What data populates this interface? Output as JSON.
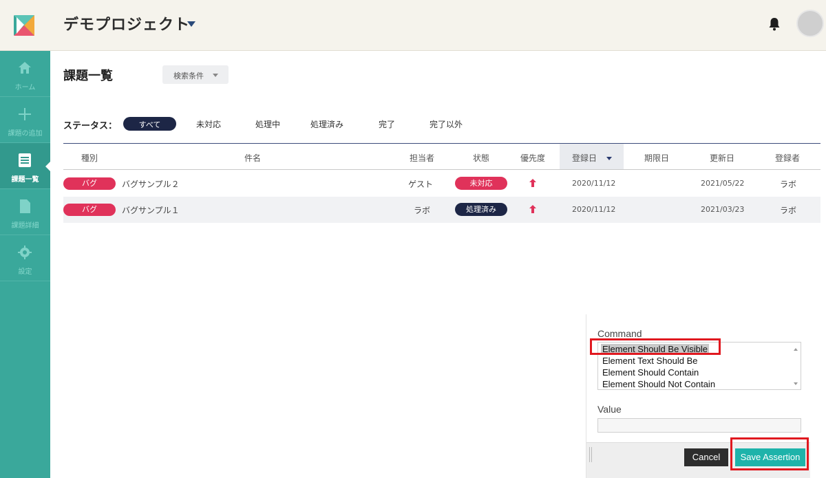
{
  "header": {
    "project_title": "デモプロジェクト"
  },
  "sidebar": {
    "items": [
      {
        "label": "ホーム",
        "icon": "home-icon"
      },
      {
        "label": "課題の追加",
        "icon": "plus-icon"
      },
      {
        "label": "課題一覧",
        "icon": "list-icon",
        "active": true
      },
      {
        "label": "課題詳細",
        "icon": "document-icon"
      },
      {
        "label": "設定",
        "icon": "gear-icon"
      }
    ]
  },
  "page": {
    "title": "課題一覧",
    "filter_label": "検索条件"
  },
  "status_filter": {
    "label": "ステータス：",
    "options": [
      "すべて",
      "未対応",
      "処理中",
      "処理済み",
      "完了",
      "完了以外"
    ],
    "selected": "すべて"
  },
  "table": {
    "columns": [
      "種別",
      "件名",
      "担当者",
      "状態",
      "優先度",
      "登録日",
      "期限日",
      "更新日",
      "登録者"
    ],
    "sorted_column": "登録日",
    "rows": [
      {
        "type": "バグ",
        "subject": "バグサンプル２",
        "assignee": "ゲスト",
        "status": "未対応",
        "priority": "high",
        "registered": "2020/11/12",
        "due": "",
        "updated": "2021/05/22",
        "registrant": "ラボ"
      },
      {
        "type": "バグ",
        "subject": "バグサンプル１",
        "assignee": "ラボ",
        "status": "処理済み",
        "priority": "high",
        "registered": "2020/11/12",
        "due": "",
        "updated": "2021/03/23",
        "registrant": "ラボ"
      }
    ]
  },
  "assertion_panel": {
    "command_label": "Command",
    "commands": [
      "Element Should Be Visible",
      "Element Text Should Be",
      "Element Should Contain",
      "Element Should Not Contain"
    ],
    "selected_command": "Element Should Be Visible",
    "value_label": "Value",
    "value": "",
    "cancel_label": "Cancel",
    "save_label": "Save Assertion"
  },
  "colors": {
    "accent": "#3aa89b",
    "navy": "#1d2646",
    "bug_red": "#e0325a",
    "save_teal": "#1eb3aa",
    "highlight_red": "#e0181f"
  }
}
